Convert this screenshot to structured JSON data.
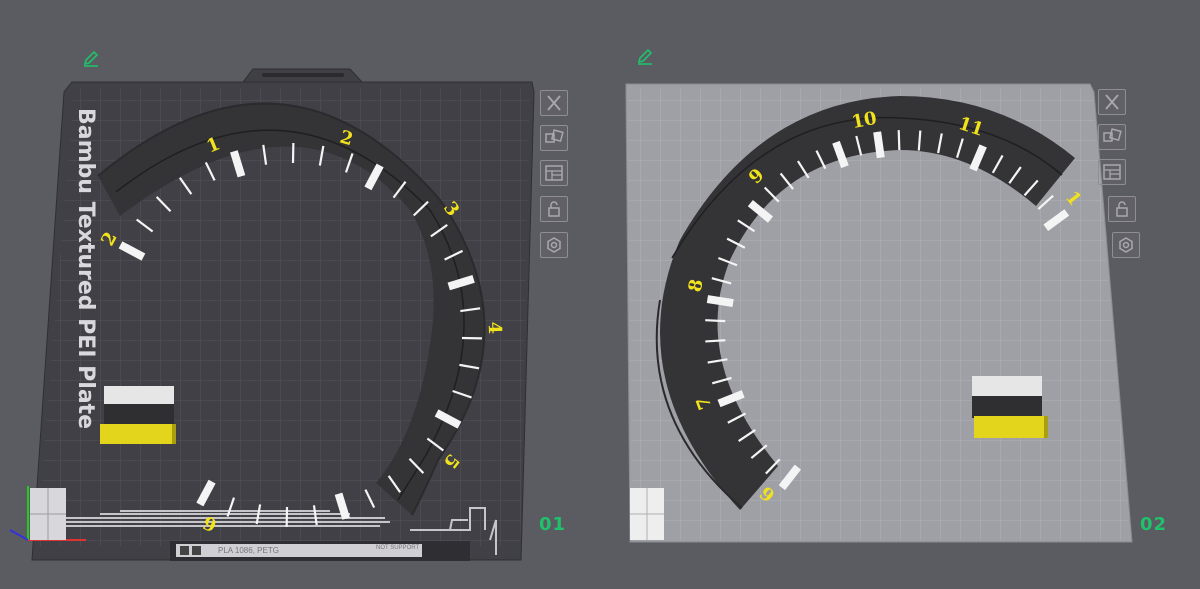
{
  "plates": [
    {
      "id": "plate-1",
      "number": "01",
      "label": "Bambu Textured PEI Plate",
      "dial_labels": [
        "2",
        "1",
        "2",
        "3",
        "4",
        "5",
        "6"
      ],
      "strip_text": "PLA 1086, PETG",
      "strip_text_small": "NOT SUPPORT"
    },
    {
      "id": "plate-2",
      "number": "02",
      "dial_labels": [
        "10",
        "11",
        "1",
        "9",
        "8",
        "7",
        "6"
      ]
    }
  ],
  "toolbar_icons": [
    "close-icon",
    "arrange-icon",
    "layout-icon",
    "lock-icon",
    "settings-icon"
  ],
  "colors": {
    "plate_dark": "#3b3b40",
    "plate_light": "#9a9aa0",
    "dial": "#363638",
    "number_yellow": "#f2e21c",
    "plate_number": "#1fc26a"
  }
}
